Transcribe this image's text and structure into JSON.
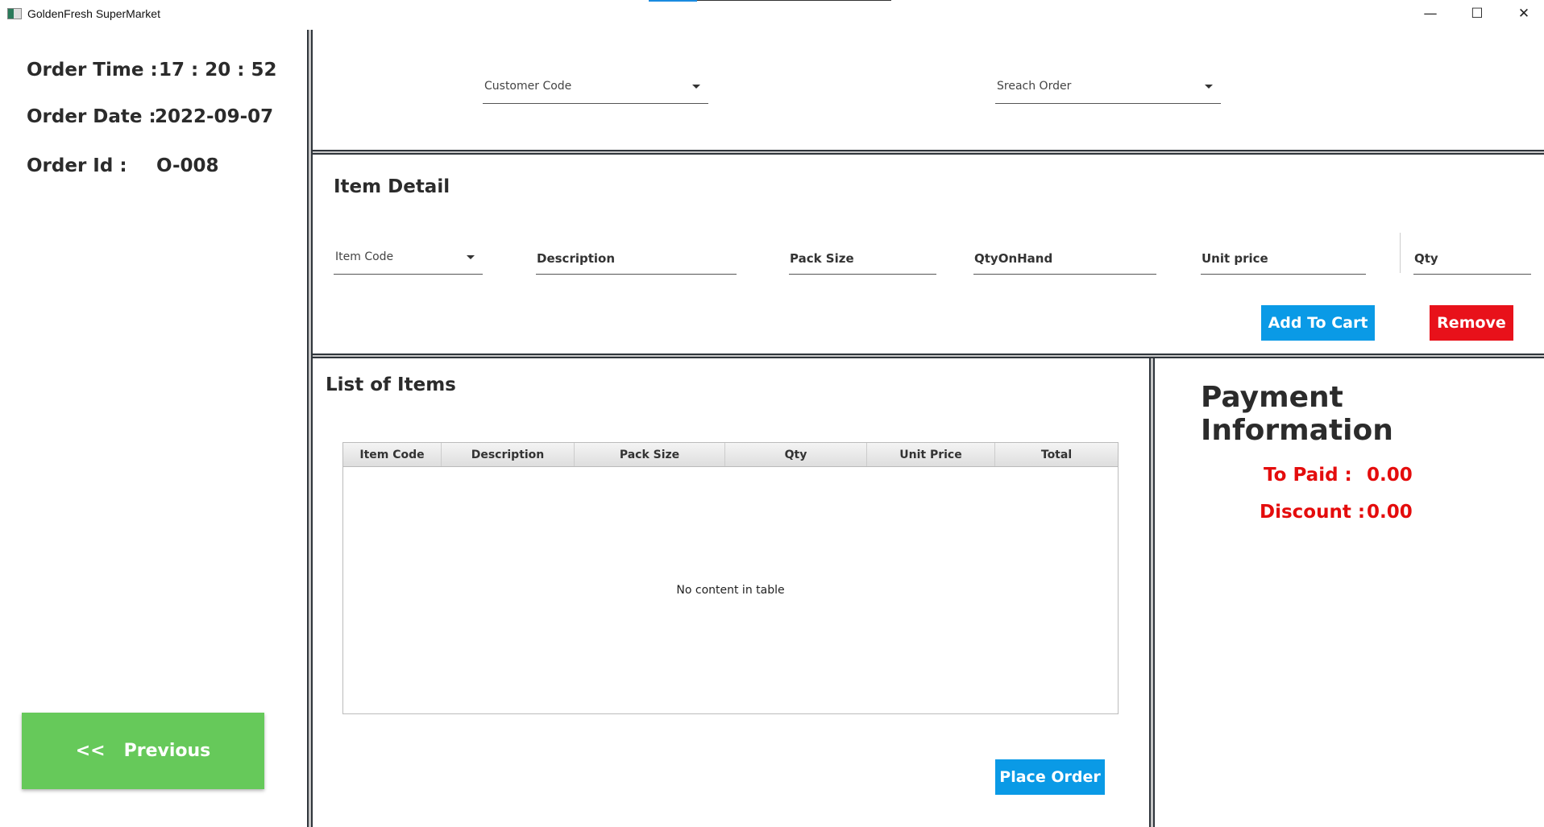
{
  "window": {
    "title": "GoldenFresh SuperMarket",
    "minimize": "—",
    "maximize": "☐",
    "close": "✕"
  },
  "order": {
    "time_label": "Order Time  :",
    "time_value": "17 : 20 : 52",
    "date_label": "Order Date  :",
    "date_value": "2022-09-07",
    "id_label": "Order Id  :",
    "id_value": "O-008"
  },
  "nav": {
    "previous_label": "<<   Previous"
  },
  "top": {
    "customer_code": "Customer Code",
    "search_order": "Sreach Order"
  },
  "item_detail": {
    "title": "Item Detail",
    "item_code": "Item Code",
    "description": "Description",
    "pack_size": "Pack Size",
    "qty_on_hand": "QtyOnHand",
    "unit_price": "Unit price",
    "qty": "Qty",
    "add_to_cart": "Add To Cart",
    "remove": "Remove"
  },
  "list": {
    "title": "List of  Items",
    "columns": [
      "Item Code",
      "Description",
      "Pack Size",
      "Qty",
      "Unit Price",
      "Total"
    ],
    "empty_text": "No content in table",
    "place_order": "Place Order"
  },
  "payment": {
    "title": "Payment Information",
    "to_paid_label": "To Paid :",
    "to_paid_value": "0.00",
    "discount_label": "Discount :",
    "discount_value": "0.00"
  },
  "colors": {
    "green": "#66c95a",
    "blue": "#0a9ae6",
    "red": "#e8111a",
    "text_red": "#e40c0c"
  }
}
